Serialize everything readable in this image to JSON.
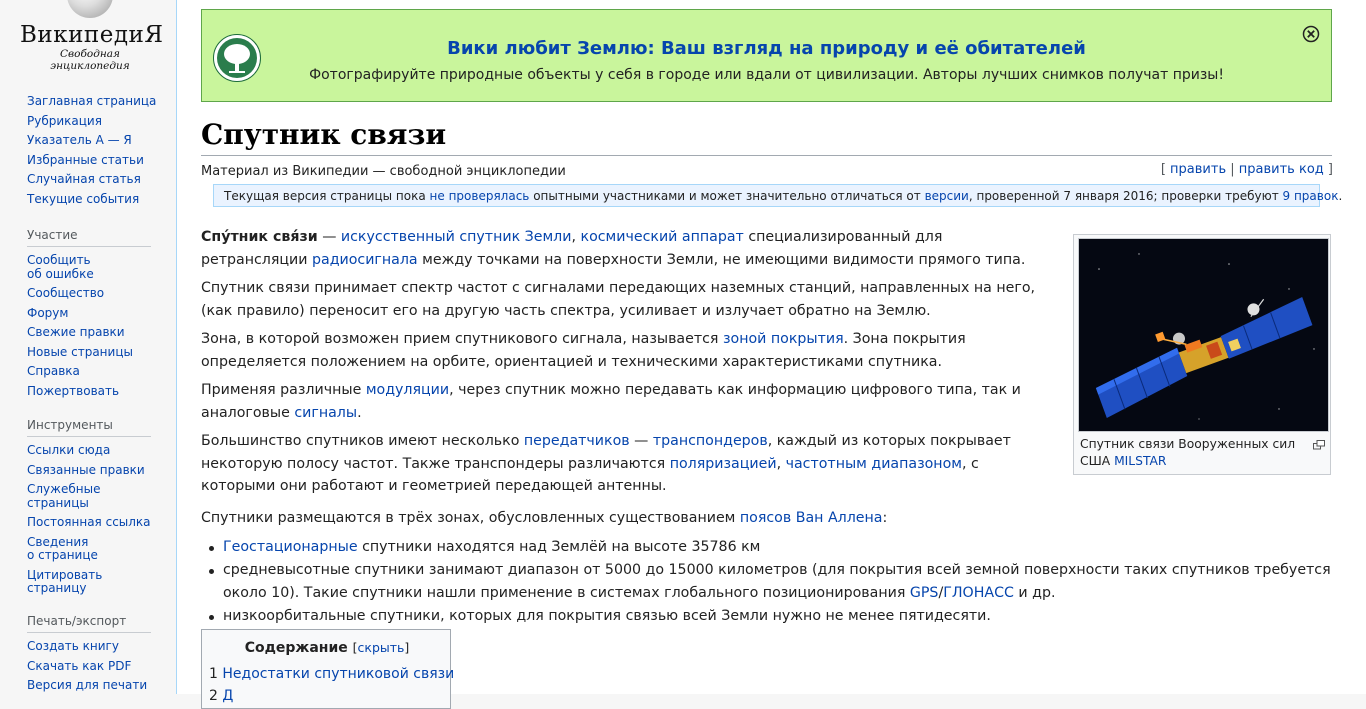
{
  "logo": {
    "wordmark": "ВикипедиЯ",
    "tagline": "Свободная энциклопедия"
  },
  "sidebar": {
    "nav": [
      {
        "label": "Заглавная страница"
      },
      {
        "label": "Рубрикация"
      },
      {
        "label": "Указатель А — Я"
      },
      {
        "label": "Избранные статьи"
      },
      {
        "label": "Случайная статья"
      },
      {
        "label": "Текущие события"
      }
    ],
    "participation": {
      "heading": "Участие",
      "items": [
        {
          "label": "Сообщить\nоб ошибке"
        },
        {
          "label": "Сообщество"
        },
        {
          "label": "Форум"
        },
        {
          "label": "Свежие правки"
        },
        {
          "label": "Новые страницы"
        },
        {
          "label": "Справка"
        },
        {
          "label": "Пожертвовать"
        }
      ]
    },
    "tools": {
      "heading": "Инструменты",
      "items": [
        {
          "label": "Ссылки сюда"
        },
        {
          "label": "Связанные правки"
        },
        {
          "label": "Служебные\nстраницы"
        },
        {
          "label": "Постоянная ссылка"
        },
        {
          "label": "Сведения\nо странице"
        },
        {
          "label": "Цитировать\nстраницу"
        }
      ]
    },
    "print": {
      "heading": "Печать/экспорт",
      "items": [
        {
          "label": "Создать книгу"
        },
        {
          "label": "Скачать как PDF"
        },
        {
          "label": "Версия для печати"
        }
      ]
    }
  },
  "banner": {
    "title": "Вики любит Землю: Ваш взгляд на природу и её обитателей",
    "text": "Фотографируйте природные объекты у себя в городе или вдали от цивилизации. Авторы лучших снимков получат призы!",
    "icon": "tree-icon",
    "close_icon": "close-icon"
  },
  "page": {
    "title": "Спутник связи",
    "subtitle": "Материал из Википедии — свободной энциклопедии",
    "edit_links": {
      "open": "[",
      "edit": "править",
      "sep": "|",
      "edit_source": "править код",
      "close": "]"
    }
  },
  "review_notice": {
    "t1": "Текущая версия страницы пока ",
    "l1": "не проверялась",
    "t2": " опытными участниками и может значительно отличаться от ",
    "l2": "версии",
    "t3": ", проверенной 7 января 2016; проверки требуют ",
    "l3": "9 правок",
    "t4": "."
  },
  "article": {
    "p1": {
      "b1": "Спу́тник свя́зи",
      "t1": " — ",
      "l1": "искусственный спутник Земли",
      "t2": ", ",
      "l2": "космический аппарат",
      "t3": " специализированный для ретрансляции ",
      "l3": "радиосигнала",
      "t4": " между точками на поверхности Земли, не имеющими видимости прямого типа."
    },
    "p2": "Спутник связи принимает спектр частот с сигналами передающих наземных станций, направленных на него, (как правило) переносит его на другую часть спектра, усиливает и излучает обратно на Землю.",
    "p3": {
      "t1": "Зона, в которой возможен прием спутникового сигнала, называется ",
      "l1": "зоной покрытия",
      "t2": ". Зона покрытия определяется положением на орбите, ориентацией и техническими характеристиками спутника."
    },
    "p4": {
      "t1": "Применяя различные ",
      "l1": "модуляции",
      "t2": ", через спутник можно передавать как информацию цифрового типа, так и аналоговые ",
      "l2": "сигналы",
      "t3": "."
    },
    "p5": {
      "t1": "Большинство спутников имеют несколько ",
      "l1": "передатчиков",
      "t2": " — ",
      "l2": "транспондеров",
      "t3": ", каждый из которых покрывает некоторую полосу частот. Также транспондеры различаются ",
      "l3": "поляризацией",
      "t4": ", ",
      "l4": "частотным диапазоном",
      "t5": ", с которыми они работают и геометрией передающей антенны."
    },
    "p6": {
      "t1": "Спутники размещаются в трёх зонах, обусловленных существованием ",
      "l1": "поясов Ван Аллена",
      "t2": ":"
    },
    "bullets": {
      "b1": {
        "l1": "Геостационарные",
        "t1": " спутники находятся над Землёй на высоте 35786 км"
      },
      "b2": {
        "t1": "средневысотные спутники занимают диапазон от 5000 до 15000 километров (для покрытия всей земной поверхности таких спутников требуется около 10). Такие спутники нашли применение в системах глобального позиционирования ",
        "l1": "GPS",
        "t2": "/",
        "l2": "ГЛОНАСС",
        "t3": " и др."
      },
      "b3": {
        "t1": "низкоорбитальные спутники, которых для покрытия связью всей Земли нужно не менее пятидесяти."
      }
    }
  },
  "infobox": {
    "caption_text": "Спутник связи Вооруженных сил США ",
    "caption_link": "MILSTAR",
    "enlarge_icon": "enlarge-icon"
  },
  "toc": {
    "title": "Содержание",
    "toggle_open": "[",
    "toggle_label": "скрыть",
    "toggle_close": "]",
    "items": [
      {
        "num": "1",
        "label": "Недостатки спутниковой связи"
      },
      {
        "num": "2",
        "label": "Д"
      }
    ]
  },
  "colors": {
    "link": "#0645ad",
    "banner_bg": "#c9f59c",
    "notice_bg": "#eaf3ff"
  }
}
